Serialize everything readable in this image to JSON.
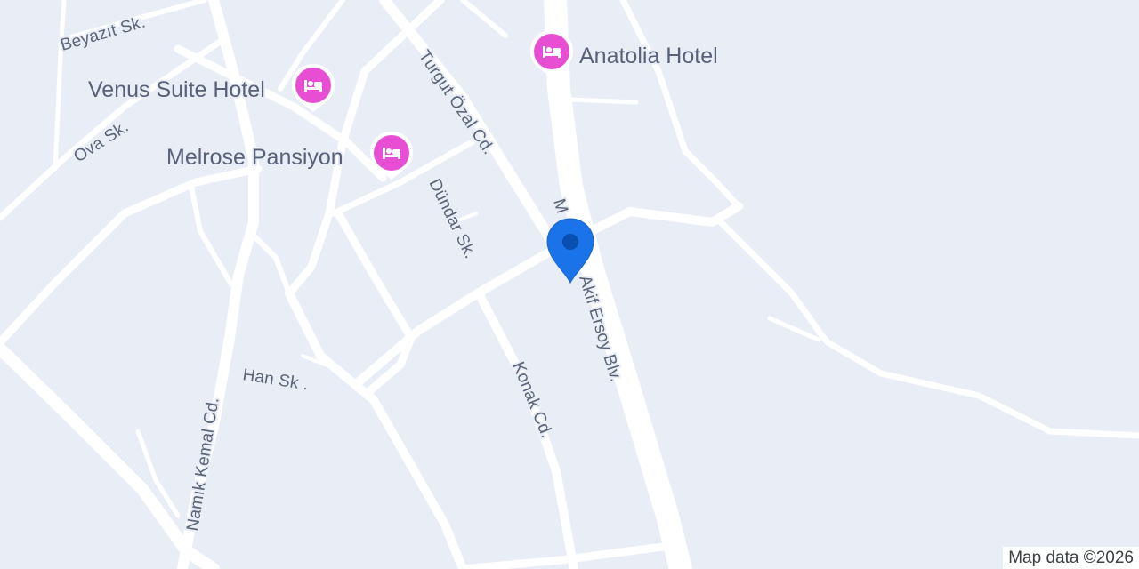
{
  "map": {
    "colors": {
      "land": "#e9eef6",
      "road": "#ffffff",
      "road_label": "#5b6577",
      "poi_label": "#59617a",
      "lodging_pin": "#e84ed3",
      "location_marker": "#1a73e8"
    },
    "streets": {
      "beyazit": "Beyazıt Sk.",
      "ova": "Ova Sk.",
      "turgut_ozal": "Turgut Özal Cd.",
      "mehmet_akif_prefix": "M",
      "mehmet_akif_suffix": "Akif Ersoy Blv.",
      "dundar": "Dündar Sk.",
      "konak": "Konak Cd.",
      "han": "Han Sk .",
      "namik_kemal": "Namık Kemal Cd."
    },
    "pois": [
      {
        "name": "Anatolia Hotel",
        "icon": "hotel-bed-icon"
      },
      {
        "name": "Venus Suite Hotel",
        "icon": "hotel-bed-icon"
      },
      {
        "name": "Melrose Pansiyon",
        "icon": "hotel-bed-icon"
      }
    ],
    "marker": {
      "icon": "location-pin-icon"
    },
    "attribution": "Map data ©2026"
  }
}
